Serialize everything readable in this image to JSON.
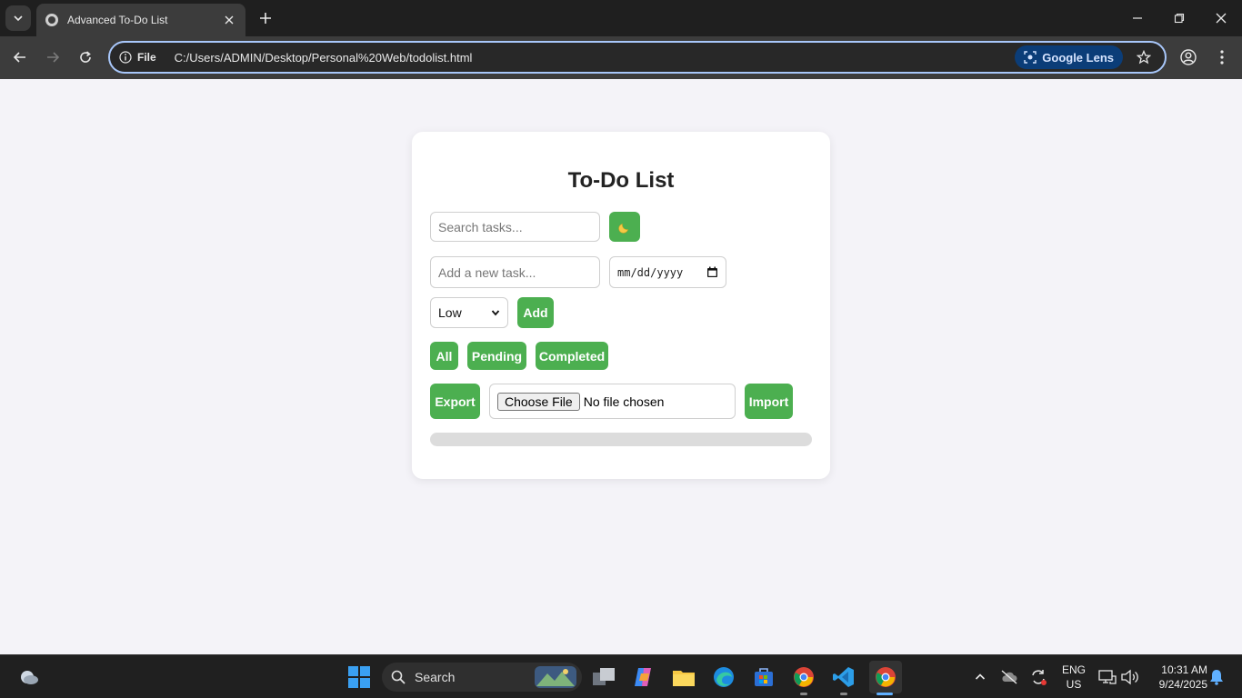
{
  "browser": {
    "tab_title": "Advanced To-Do List",
    "site_chip": "File",
    "url": "C:/Users/ADMIN/Desktop/Personal%20Web/todolist.html",
    "lens_label": "Google Lens"
  },
  "app": {
    "title": "To-Do List",
    "search_placeholder": "Search tasks...",
    "theme_toggle_icon": "moon-icon",
    "task_placeholder": "Add a new task...",
    "date_placeholder": "mm/dd/yyyy",
    "priority_selected": "Low",
    "add_label": "Add",
    "filters": [
      "All",
      "Pending",
      "Completed"
    ],
    "export_label": "Export",
    "choose_file_label": "Choose File",
    "no_file_text": "No file chosen",
    "import_label": "Import",
    "progress_fraction": 0,
    "accent_color": "#4caf50"
  },
  "taskbar": {
    "search_label": "Search",
    "lang_primary": "ENG",
    "lang_secondary": "US",
    "time": "10:31 AM",
    "date": "9/24/2025"
  }
}
